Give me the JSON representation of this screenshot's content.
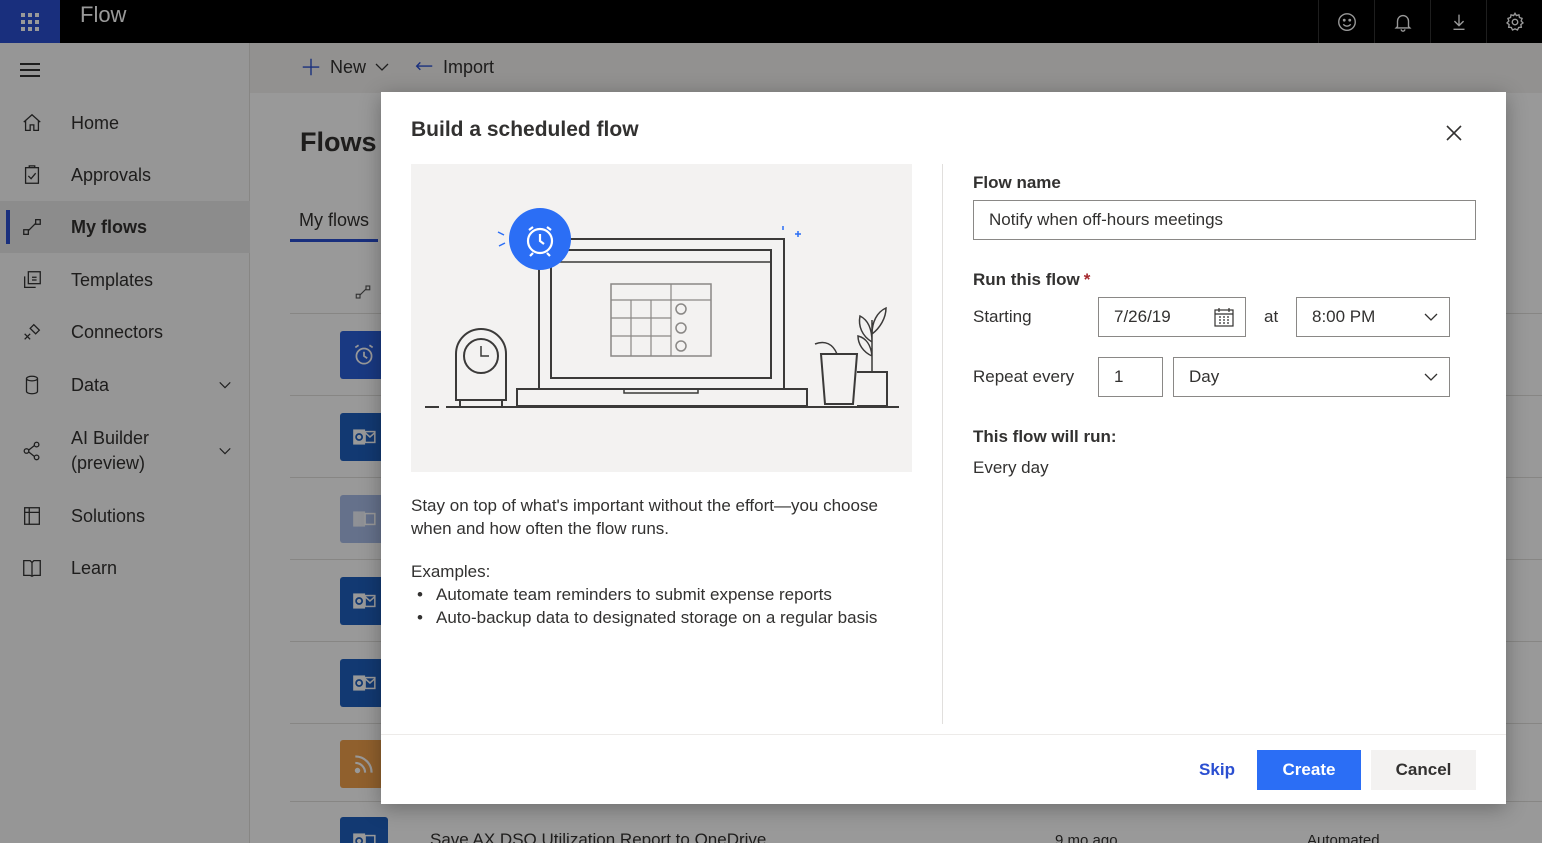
{
  "app": {
    "title": "Flow"
  },
  "topbar": {
    "icons": [
      "smiley-icon",
      "bell-icon",
      "download-icon",
      "gear-icon"
    ]
  },
  "nav": {
    "items": [
      {
        "label": "Home",
        "icon": "home-icon"
      },
      {
        "label": "Approvals",
        "icon": "clipboard-icon"
      },
      {
        "label": "My flows",
        "icon": "flow-icon",
        "active": true
      },
      {
        "label": "Templates",
        "icon": "templates-icon"
      },
      {
        "label": "Connectors",
        "icon": "connectors-icon"
      },
      {
        "label": "Data",
        "icon": "database-icon",
        "expandable": true
      },
      {
        "label": "AI Builder\n(preview)",
        "icon": "ai-builder-icon",
        "expandable": true
      },
      {
        "label": "Solutions",
        "icon": "solutions-icon"
      },
      {
        "label": "Learn",
        "icon": "book-icon"
      }
    ]
  },
  "commandbar": {
    "new_label": "New",
    "import_label": "Import"
  },
  "main": {
    "title": "Flows",
    "tab": "My flows",
    "partial_row": {
      "name": "Save AX DSO Utilization Report to OneDrive",
      "modified": "9 mo ago",
      "type": "Automated"
    }
  },
  "dialog": {
    "title": "Build a scheduled flow",
    "description": "Stay on top of what's important without the effort—you choose when and how often the flow runs.",
    "examples_label": "Examples:",
    "examples": [
      "Automate team reminders to submit expense reports",
      "Auto-backup data to designated storage on a regular basis"
    ],
    "flow_name_label": "Flow name",
    "flow_name_value": "Notify when off-hours meetings",
    "run_label": "Run this flow",
    "required_marker": "*",
    "starting_label": "Starting",
    "start_date": "7/26/19",
    "at_label": "at",
    "start_time": "8:00 PM",
    "repeat_label": "Repeat every",
    "repeat_interval": "1",
    "repeat_unit": "Day",
    "summary_label": "This flow will run:",
    "summary_value": "Every day",
    "skip_label": "Skip",
    "create_label": "Create",
    "cancel_label": "Cancel"
  },
  "colors": {
    "accent": "#2b4fd1",
    "primary_button": "#2b6ef5",
    "outlook_blue": "#1f5fbf",
    "rss_orange": "#f0a04b"
  }
}
